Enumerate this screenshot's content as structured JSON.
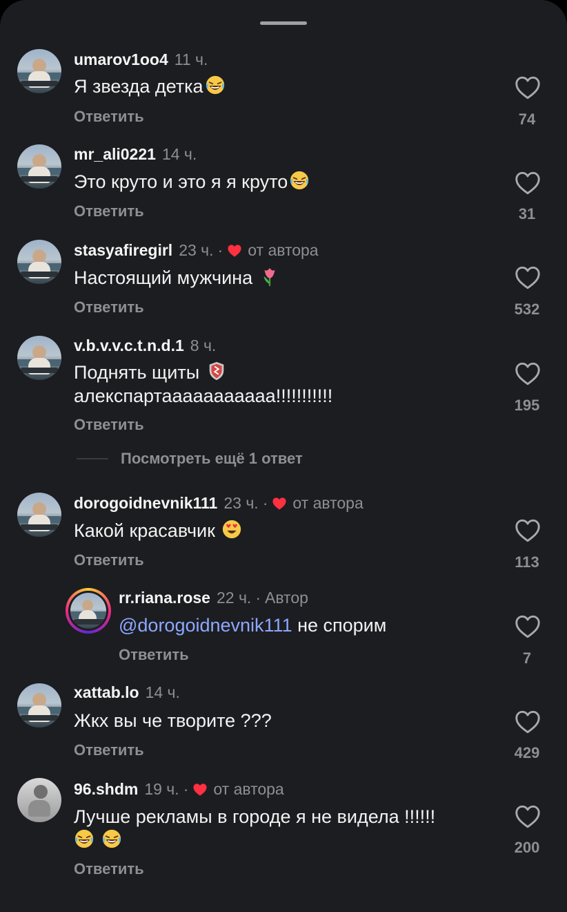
{
  "comments": [
    {
      "user": "umarov1oo4",
      "time": "11 ч.",
      "text": "Я звезда детка",
      "emoji": "laugh",
      "reply": "Ответить",
      "likes": "74"
    },
    {
      "user": "mr_ali0221",
      "time": "14 ч.",
      "text": "Это круто и это я я круто",
      "emoji": "laugh",
      "reply": "Ответить",
      "likes": "31"
    },
    {
      "user": "stasyafiregirl",
      "time": "23 ч.",
      "sep": "·",
      "author_like": "от автора",
      "text": "Настоящий мужчина ",
      "emoji": "tulip",
      "reply": "Ответить",
      "likes": "532"
    },
    {
      "user": "v.b.v.v.c.t.n.d.1",
      "time": "8 ч.",
      "text_line1": "Поднять щиты ",
      "text_line2": "алекспартааааааааааа!!!!!!!!!!!",
      "emoji": "shield",
      "reply": "Ответить",
      "likes": "195"
    },
    {
      "user": "dorogoidnevnik111",
      "time": "23 ч.",
      "sep": "·",
      "author_like": "от автора",
      "text": "Какой красавчик ",
      "emoji": "heart-eyes",
      "reply": "Ответить",
      "likes": "113"
    },
    {
      "user": "rr.riana.rose",
      "time": "22 ч.",
      "sep": "·",
      "tag": "Автор",
      "mention": "@dorogoidnevnik111",
      "text": " не спорим",
      "reply": "Ответить",
      "likes": "7"
    },
    {
      "user": "xattab.lo",
      "time": "14 ч.",
      "text": "Жкх вы че творите ???",
      "reply": "Ответить",
      "likes": "429"
    },
    {
      "user": "96.shdm",
      "time": "19 ч.",
      "sep": "·",
      "author_like": "от автора",
      "text": "Лучше рекламы в городе я не видела !!!!!!",
      "emoji": "laugh",
      "reply": "Ответить",
      "likes": "200"
    }
  ],
  "view_more": "Посмотреть ещё 1 ответ",
  "colors": {
    "background": "#1c1d21",
    "like_red": "#ff3040",
    "mention": "#8ea8ff",
    "muted": "#8e8e93"
  }
}
